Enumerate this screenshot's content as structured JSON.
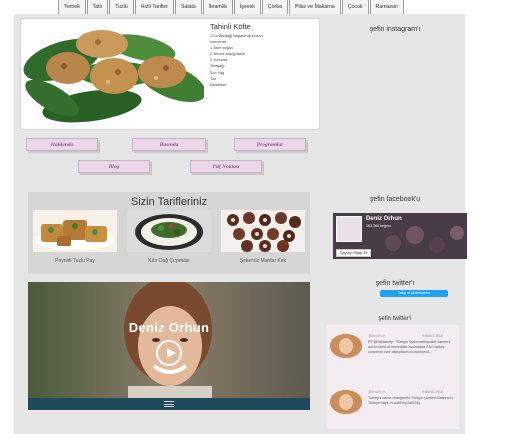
{
  "nav": [
    "Yemek",
    "Tatlı",
    "Tuzlu",
    "Hızlı Tarifler",
    "Salata",
    "İkramlık",
    "İçecek",
    "Çorba",
    "Pilav ve Makarna",
    "Çocuk",
    "Ramazan"
  ],
  "recipe": {
    "title": "Tahinli Köfte",
    "ingredients": [
      "1 Su Bardağı haşlanmış kırmızı",
      "mercimek",
      "1 Tane soğan",
      "2 Yemek kaşığı tahin",
      "2 Yumurta",
      "Tereyağı",
      "Sıvı Yağ",
      "Tuz",
      "Karabiber"
    ]
  },
  "buttons": {
    "about": "Hakkında",
    "press": "Basında",
    "programs": "Programlar",
    "blog": "Blog",
    "tips": "Püf Noktası"
  },
  "tarifler": {
    "title": "Sizin Tarifleriniz",
    "items": [
      "Peynirli Tuzlu Pay",
      "Kıtır Dağ Çırpması",
      "Şekersiz Mantar Kek"
    ]
  },
  "video": {
    "name": "Deniz Orhun"
  },
  "sidebar": {
    "instagram_title": "şefin instagram'ı",
    "facebook_title": "şefin facebook'u",
    "fb_name": "Deniz Orhun",
    "fb_likes": "163.366 beğeni",
    "fb_like": "Sayfayı Takip Et",
    "twitter_title": "şefin twitter'ı",
    "twitter_follow": "Takip et @denorhun",
    "twitter_feed_title": "şefin twitter'ı",
    "tweets": [
      {
        "user": "@denorhun",
        "date": "9 Mar 17 2015",
        "text": "RT @Ntkaanrtp: \"Türkiye Syria earthquake: farmers are in need of immediate assistance FAO raises concerns over disruptions to food prod..."
      },
      {
        "user": "@denorhun",
        "date": "9 Mar 02 2015",
        "text": "Turkey's name changed to Türkiye | United Nations in Türkiye https://t.co/kFmp2zAOay"
      }
    ]
  },
  "colors": {
    "panel_bg": "#e6e6e6",
    "button_bg": "#ecd7ea",
    "button_text": "#8a5a84",
    "twitter_blue": "#1da1f2",
    "video_bar": "#1f4a5c"
  }
}
